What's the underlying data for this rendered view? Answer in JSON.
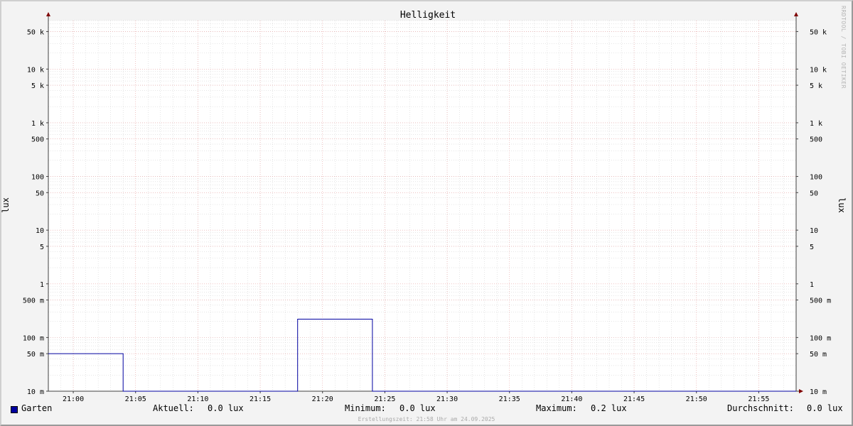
{
  "chart_data": {
    "type": "line",
    "title": "Helligkeit",
    "ylabel": "lux",
    "y_scale": "log",
    "ylim": [
      0.01,
      80000
    ],
    "x_range": [
      "20:58",
      "22:58"
    ],
    "x_ticks": [
      "21:00",
      "21:05",
      "21:10",
      "21:15",
      "21:20",
      "21:25",
      "21:30",
      "21:35",
      "21:40",
      "21:45",
      "21:50",
      "21:55"
    ],
    "y_ticks": [
      {
        "value": 0.01,
        "label": "10 m"
      },
      {
        "value": 0.05,
        "label": "50 m"
      },
      {
        "value": 0.1,
        "label": "100 m"
      },
      {
        "value": 0.5,
        "label": "500 m"
      },
      {
        "value": 1,
        "label": "1"
      },
      {
        "value": 5,
        "label": "5"
      },
      {
        "value": 10,
        "label": "10"
      },
      {
        "value": 50,
        "label": "50"
      },
      {
        "value": 100,
        "label": "100"
      },
      {
        "value": 500,
        "label": "500"
      },
      {
        "value": 1000,
        "label": "1 k"
      },
      {
        "value": 5000,
        "label": "5 k"
      },
      {
        "value": 10000,
        "label": "10 k"
      },
      {
        "value": 50000,
        "label": "50 k"
      }
    ],
    "grid": true,
    "series": [
      {
        "name": "Garten",
        "color": "#0000a0",
        "points": [
          {
            "t": "20:58",
            "v": 0.05
          },
          {
            "t": "21:04",
            "v": 0.05
          },
          {
            "t": "21:04",
            "v": 0.01
          },
          {
            "t": "21:18",
            "v": 0.01
          },
          {
            "t": "21:18",
            "v": 0.22
          },
          {
            "t": "21:24",
            "v": 0.22
          },
          {
            "t": "21:24",
            "v": 0.01
          },
          {
            "t": "21:58",
            "v": 0.01
          }
        ]
      }
    ]
  },
  "legend": {
    "series_name": "Garten",
    "current_label": "Aktuell:",
    "current_value": "0.0 lux",
    "min_label": "Minimum:",
    "min_value": "0.0 lux",
    "max_label": "Maximum:",
    "max_value": "0.2 lux",
    "avg_label": "Durchschnitt:",
    "avg_value": "0.0 lux"
  },
  "footer": "Erstellungszeit: 21:58 Uhr am 24.09.2025",
  "watermark": "RRDTOOL / TOBI OETIKER",
  "colors": {
    "series": "#0000a0",
    "major_grid": "#e8a0a0",
    "minor_grid": "#cccccc",
    "axis": "#404040",
    "arrow": "#800000"
  }
}
